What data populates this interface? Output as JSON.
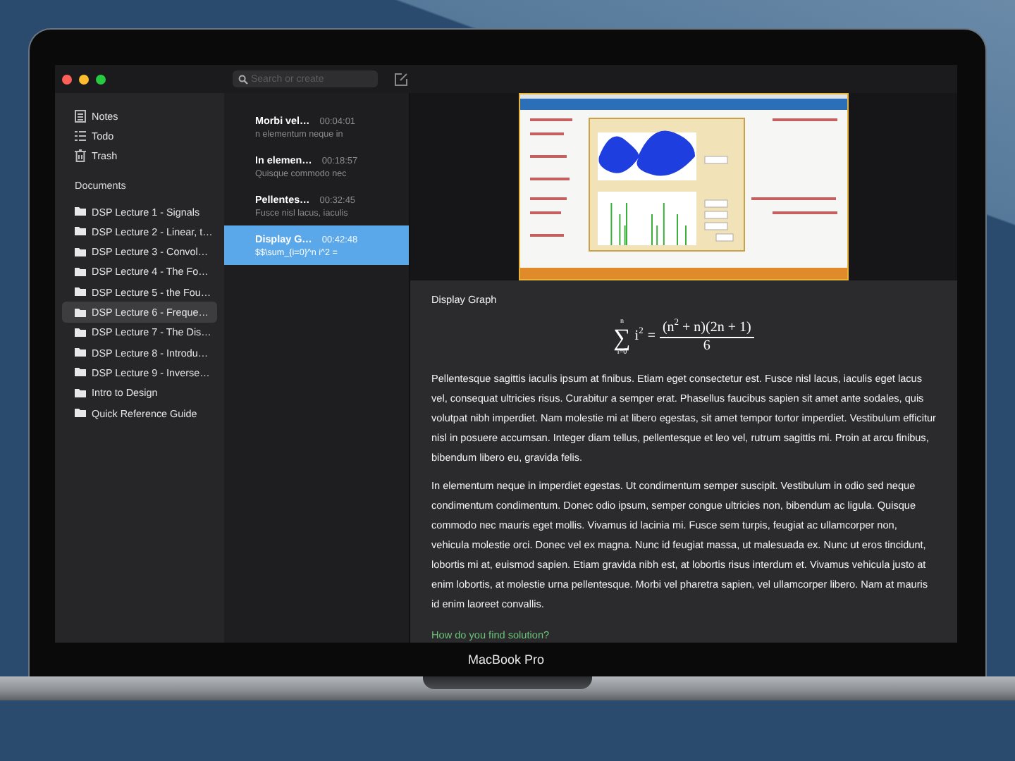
{
  "window": {
    "search": {
      "placeholder": "Search or create"
    }
  },
  "sidebar": {
    "items": [
      {
        "kind": "notes",
        "label": "Notes"
      },
      {
        "kind": "todo",
        "label": "Todo"
      },
      {
        "kind": "trash",
        "label": "Trash"
      }
    ],
    "section_title": "Documents",
    "documents": [
      {
        "label": "DSP Lecture 1 - Signals",
        "selected": false
      },
      {
        "label": "DSP Lecture 2 - Linear, t…",
        "selected": false
      },
      {
        "label": "DSP Lecture 3 - Convol…",
        "selected": false
      },
      {
        "label": "DSP Lecture 4 - The Fo…",
        "selected": false
      },
      {
        "label": "DSP Lecture 5 - the Fou…",
        "selected": false
      },
      {
        "label": "DSP Lecture 6 - Freque…",
        "selected": true
      },
      {
        "label": "DSP Lecture 7 - The Dis…",
        "selected": false
      },
      {
        "label": "DSP Lecture 8 - Introdu…",
        "selected": false
      },
      {
        "label": "DSP Lecture 9 - Inverse…",
        "selected": false
      },
      {
        "label": "Intro to Design",
        "selected": false
      },
      {
        "label": "Quick Reference Guide",
        "selected": false
      }
    ]
  },
  "notes": [
    {
      "title": "Morbi vel…",
      "time": "00:04:01",
      "preview": "n elementum neque in",
      "selected": false
    },
    {
      "title": "In elemen…",
      "time": "00:18:57",
      "preview": "Quisque commodo nec",
      "selected": false
    },
    {
      "title": "Pellentes…",
      "time": "00:32:45",
      "preview": "Fusce nisl lacus, iaculis",
      "selected": false
    },
    {
      "title": "Display G…",
      "time": "00:42:48",
      "preview": "$$\\sum_{i=0}^n i^2 =",
      "selected": true
    }
  ],
  "editor": {
    "heading": "Display Graph",
    "formula": {
      "operator": "∑",
      "upper": "n",
      "lower": "i=0",
      "term": "i$^{2}$",
      "equals": "=",
      "numerator": "(n$^{2}$ + n)(2n + 1)",
      "denominator": "6"
    },
    "paragraphs": [
      "Pellentesque sagittis iaculis ipsum at finibus. Etiam eget consectetur est. Fusce nisl lacus, iaculis eget lacus vel, consequat ultricies risus. Curabitur a semper erat. Phasellus faucibus sapien sit amet ante sodales, quis volutpat nibh imperdiet. Nam molestie mi at libero egestas, sit amet tempor tortor imperdiet. Vestibulum efficitur nisl in posuere accumsan. Integer diam tellus, pellentesque et leo vel, rutrum sagittis mi. Proin at arcu finibus, bibendum libero eu, gravida felis.",
      "In elementum neque in imperdiet egestas. Ut condimentum semper suscipit. Vestibulum in odio sed neque condimentum condimentum. Donec odio ipsum, semper congue ultricies non, bibendum ac ligula. Quisque commodo nec mauris eget mollis. Vivamus id lacinia mi. Fusce sem turpis, feugiat ac ullamcorper non, vehicula molestie orci. Donec vel ex magna. Nunc id feugiat massa, ut malesuada ex. Nunc ut eros tincidunt, lobortis mi at, euismod sapien. Etiam gravida nibh est, at lobortis risus interdum et. Vivamus vehicula justo at enim lobortis, at molestie urna pellentesque. Morbi vel pharetra sapien, vel ullamcorper libero. Nam at mauris id enim laoreet convallis."
    ],
    "link": "How do you find solution?"
  },
  "device": {
    "label": "MacBook Pro"
  }
}
